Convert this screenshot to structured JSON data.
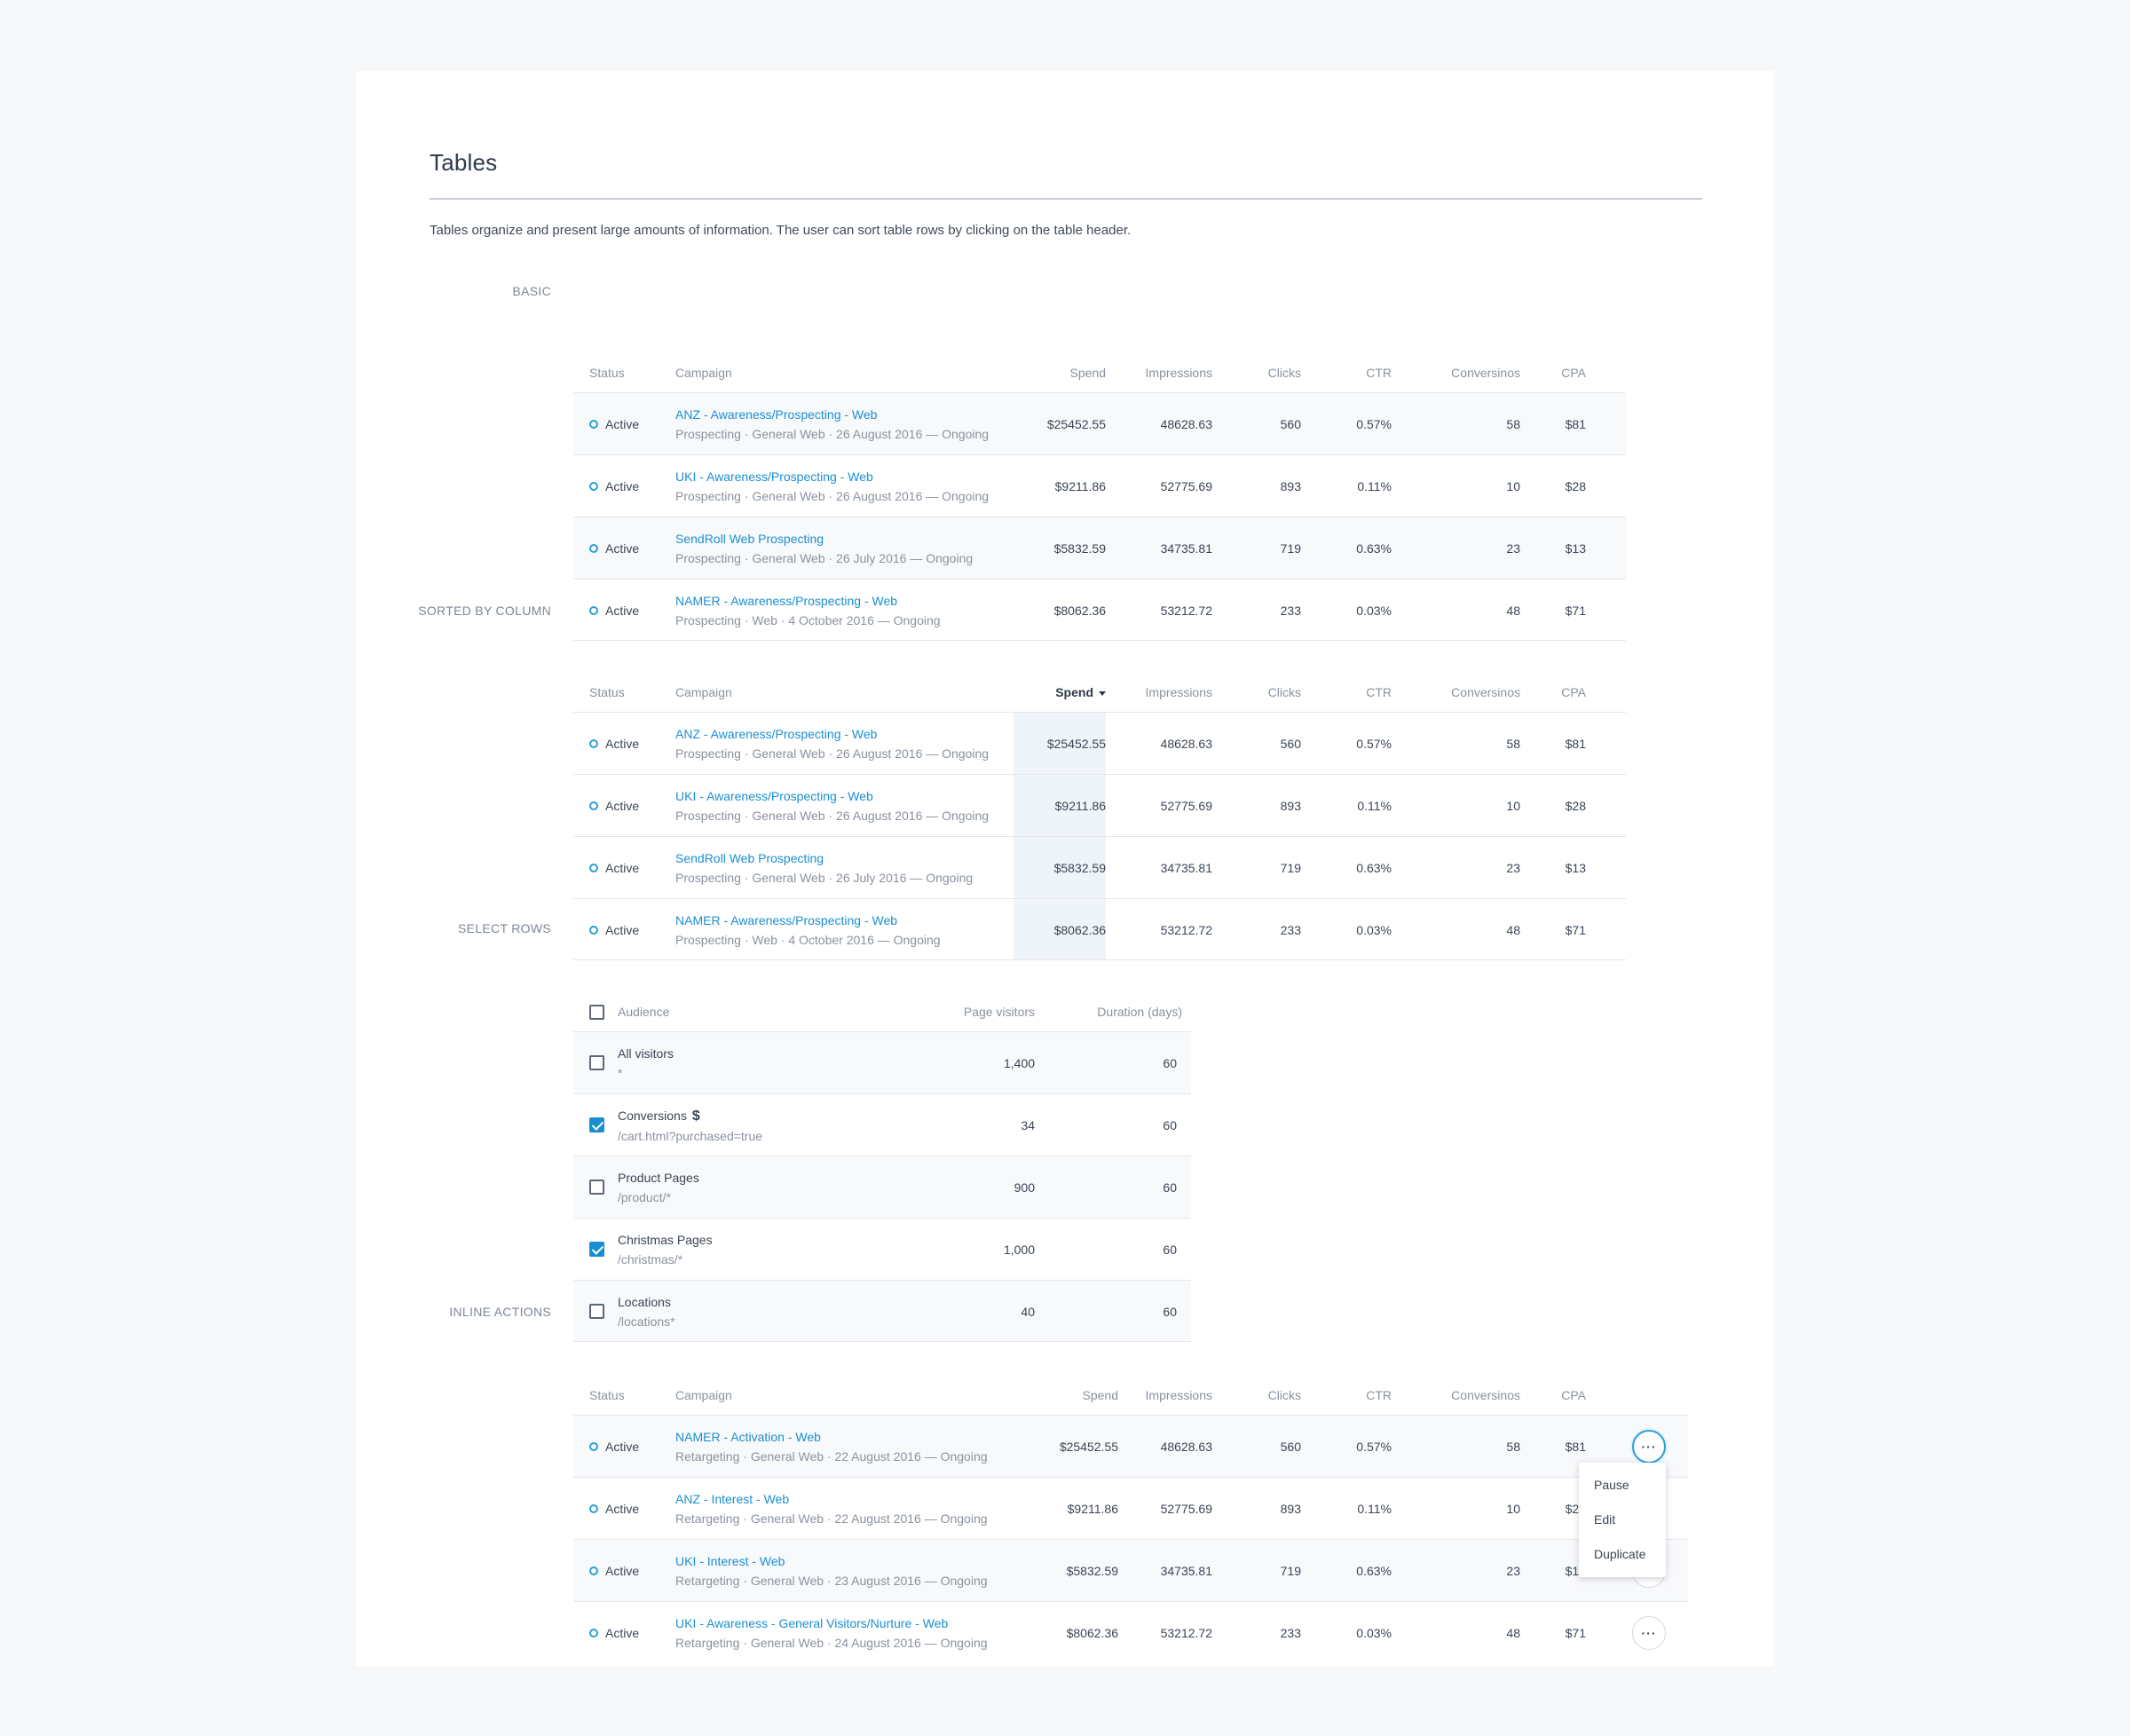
{
  "page": {
    "title": "Tables",
    "intro": "Tables organize and present large amounts of information. The user can sort table rows by clicking on the table header."
  },
  "sections": {
    "basic": "BASIC",
    "sorted": "SORTED BY COLUMN",
    "select": "SELECT ROWS",
    "inline": "INLINE ACTIONS"
  },
  "campaign_headers": {
    "status": "Status",
    "campaign": "Campaign",
    "spend": "Spend",
    "impressions": "Impressions",
    "clicks": "Clicks",
    "ctr": "CTR",
    "conversions": "Conversinos",
    "cpa": "CPA"
  },
  "basic_rows": [
    {
      "status": "Active",
      "name": "ANZ - Awareness/Prospecting - Web",
      "meta": "Prospecting · General Web · 26 August 2016 — Ongoing",
      "spend": "$25452.55",
      "impressions": "48628.63",
      "clicks": "560",
      "ctr": "0.57%",
      "conversions": "58",
      "cpa": "$81"
    },
    {
      "status": "Active",
      "name": "UKI - Awareness/Prospecting - Web",
      "meta": "Prospecting · General Web · 26 August 2016 — Ongoing",
      "spend": "$9211.86",
      "impressions": "52775.69",
      "clicks": "893",
      "ctr": "0.11%",
      "conversions": "10",
      "cpa": "$28"
    },
    {
      "status": "Active",
      "name": "SendRoll Web Prospecting",
      "meta": "Prospecting · General Web · 26 July 2016 — Ongoing",
      "spend": "$5832.59",
      "impressions": "34735.81",
      "clicks": "719",
      "ctr": "0.63%",
      "conversions": "23",
      "cpa": "$13"
    },
    {
      "status": "Active",
      "name": "NAMER - Awareness/Prospecting - Web",
      "meta": "Prospecting · Web · 4 October 2016 — Ongoing",
      "spend": "$8062.36",
      "impressions": "53212.72",
      "clicks": "233",
      "ctr": "0.03%",
      "conversions": "48",
      "cpa": "$71"
    }
  ],
  "select": {
    "headers": {
      "audience": "Audience",
      "visitors": "Page visitors",
      "duration": "Duration (days)"
    },
    "rows": [
      {
        "name": "All visitors",
        "path": "*",
        "visitors": "1,400",
        "duration": "60",
        "checked": false,
        "dollar": ""
      },
      {
        "name": "Conversions",
        "path": "/cart.html?purchased=true",
        "visitors": "34",
        "duration": "60",
        "checked": true,
        "dollar": "$"
      },
      {
        "name": "Product Pages",
        "path": "/product/*",
        "visitors": "900",
        "duration": "60",
        "checked": false,
        "dollar": ""
      },
      {
        "name": "Christmas Pages",
        "path": "/christmas/*",
        "visitors": "1,000",
        "duration": "60",
        "checked": true,
        "dollar": ""
      },
      {
        "name": "Locations",
        "path": "/locations*",
        "visitors": "40",
        "duration": "60",
        "checked": false,
        "dollar": ""
      }
    ]
  },
  "inline_rows": [
    {
      "status": "Active",
      "name": "NAMER - Activation - Web",
      "meta": "Retargeting · General Web · 22 August 2016 — Ongoing",
      "spend": "$25452.55",
      "impressions": "48628.63",
      "clicks": "560",
      "ctr": "0.57%",
      "conversions": "58",
      "cpa": "$81"
    },
    {
      "status": "Active",
      "name": "ANZ - Interest - Web",
      "meta": "Retargeting · General Web · 22 August 2016 — Ongoing",
      "spend": "$9211.86",
      "impressions": "52775.69",
      "clicks": "893",
      "ctr": "0.11%",
      "conversions": "10",
      "cpa": "$28"
    },
    {
      "status": "Active",
      "name": "UKI - Interest - Web",
      "meta": "Retargeting · General Web · 23 August 2016 — Ongoing",
      "spend": "$5832.59",
      "impressions": "34735.81",
      "clicks": "719",
      "ctr": "0.63%",
      "conversions": "23",
      "cpa": "$13"
    },
    {
      "status": "Active",
      "name": "UKI - Awareness - General Visitors/Nurture - Web",
      "meta": "Retargeting · General Web · 24 August 2016 — Ongoing",
      "spend": "$8062.36",
      "impressions": "53212.72",
      "clicks": "233",
      "ctr": "0.03%",
      "conversions": "48",
      "cpa": "$71"
    }
  ],
  "actions_menu": {
    "more_label": "···",
    "items": [
      "Pause",
      "Edit",
      "Duplicate"
    ]
  },
  "colors": {
    "accent": "#1a8fd0",
    "status_ring": "#2a9fd8",
    "sorted_column": "#eff4f8"
  }
}
